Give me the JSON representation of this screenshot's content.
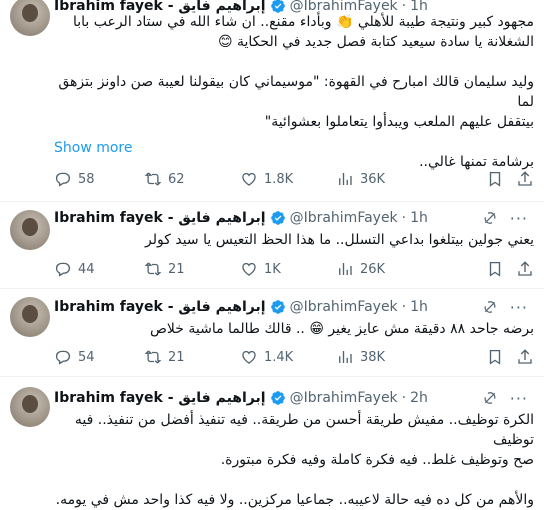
{
  "tweets": [
    {
      "name": "Ibrahim fayek - إبراهيم فايق",
      "handle": "@IbrahimFayek",
      "time": "1h",
      "text": "مجهود كبير ونتيجة طيبة للأهلي 👏 وبأداء مقنع.. ان شاء الله في ستاد الرعب بابا\nالشغلانة يا سادة سيعيد كتابة فصل جديد في الحكاية 😊\n\nوليد سليمان قالك امبارح في القهوة: \"موسيماني كان بيقولنا لعيبة صن داونز بتزهق لما\nبيتقفل عليهم الملعب ويبدأوا يتعاملوا بعشوائية\"\n\nبرشامة تمنها غالي..",
      "show_more": "Show more",
      "replies": "58",
      "retweets": "62",
      "likes": "1.8K",
      "views": "36K"
    },
    {
      "name": "Ibrahim fayek - إبراهيم فايق",
      "handle": "@IbrahimFayek",
      "time": "1h",
      "text": "يعني جولين بيتلغوا بداعي التسلل.. ما هذا الحظ التعيس يا سيد كولر",
      "replies": "44",
      "retweets": "21",
      "likes": "1K",
      "views": "26K"
    },
    {
      "name": "Ibrahim fayek - إبراهيم فايق",
      "handle": "@IbrahimFayek",
      "time": "1h",
      "text": "برضه جاحد ٨٨ دقيقة مش عايز يغير 😁 .. قالك طالما ماشية خلاص",
      "replies": "54",
      "retweets": "21",
      "likes": "1.4K",
      "views": "38K"
    },
    {
      "name": "Ibrahim fayek - إبراهيم فايق",
      "handle": "@IbrahimFayek",
      "time": "2h",
      "text": "الكرة توظيف.. مفيش طريقة أحسن من طريقة.. فيه تنفيذ أفضل من تنفيذ.. فيه توظيف\nصح وتوظيف غلط.. فيه فكرة كاملة وفيه فكرة مبتورة.\n\nوالأهم من كل ده فيه حالة لاعيبه.. جماعيا مركزين.. ولا فيه كذا واحد مش في يومه."
    }
  ],
  "colors": {
    "accent": "#1d9bf0",
    "muted": "#536471",
    "text": "#0f1419"
  }
}
